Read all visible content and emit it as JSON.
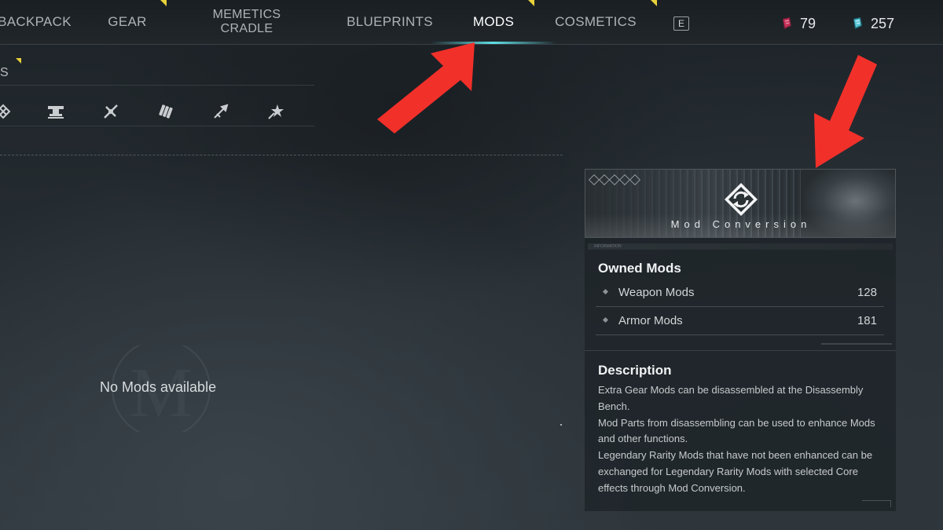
{
  "nav": {
    "tabs": [
      {
        "label": "BACKPACK",
        "active": false
      },
      {
        "label": "GEAR",
        "active": false
      },
      {
        "label": "MEMETICS CRADLE",
        "line1": "MEMETICS",
        "line2": "CRADLE",
        "active": false
      },
      {
        "label": "BLUEPRINTS",
        "active": false
      },
      {
        "label": "MODS",
        "active": true
      },
      {
        "label": "COSMETICS",
        "active": false
      }
    ],
    "next_key_hint": "E",
    "currencies": [
      {
        "icon": "red-crystal-icon",
        "value": "79",
        "color": "#c8325a"
      },
      {
        "icon": "blue-crystal-icon",
        "value": "257",
        "color": "#5cc7d8"
      }
    ]
  },
  "filter": {
    "label": "S",
    "icons": [
      "all-mods-icon",
      "anvil-icon",
      "crossed-tools-icon",
      "ammo-icon",
      "arrows-icon",
      "burst-icon"
    ]
  },
  "main": {
    "empty_message": "No Mods available",
    "empty_emblem": "M"
  },
  "info_panel": {
    "banner_title": "Mod Conversion",
    "banner_icon": "mod-conversion-icon",
    "strip_text": "INFORMATION",
    "owned_title": "Owned Mods",
    "owned_mods": [
      {
        "name": "Weapon Mods",
        "count": "128"
      },
      {
        "name": "Armor Mods",
        "count": "181"
      }
    ],
    "description_title": "Description",
    "description_lines": [
      "Extra Gear Mods can be disassembled at the Disassembly Bench.",
      "Mod Parts from disassembling can be used to enhance Mods and other functions.",
      "Legendary Rarity Mods that have not been enhanced can be exchanged for Legendary Rarity Mods with selected Core effects through Mod Conversion."
    ]
  },
  "colors": {
    "accent_yellow": "#e8d23a",
    "active_underline": "#5fe0e6",
    "annotation_red": "#f2302a"
  }
}
